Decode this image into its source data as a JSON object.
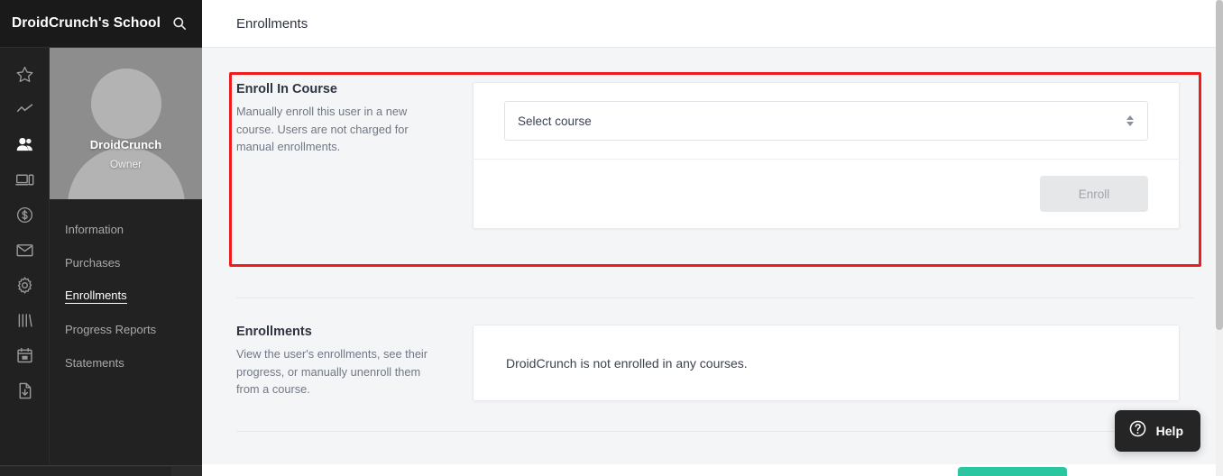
{
  "brand": {
    "title": "DroidCrunch's School",
    "search_icon": "search-icon"
  },
  "rail": {
    "items": [
      {
        "icon": "star-icon",
        "active": false
      },
      {
        "icon": "analytics-line-chart-icon",
        "active": false
      },
      {
        "icon": "users-people-icon",
        "active": true
      },
      {
        "icon": "devices-icon",
        "active": false
      },
      {
        "icon": "dollar-coin-icon",
        "active": false
      },
      {
        "icon": "mail-envelope-icon",
        "active": false
      },
      {
        "icon": "gear-settings-icon",
        "active": false
      },
      {
        "icon": "library-bars-icon",
        "active": false
      },
      {
        "icon": "calendar-icon",
        "active": false
      },
      {
        "icon": "file-download-icon",
        "active": false
      }
    ]
  },
  "profile": {
    "name": "DroidCrunch",
    "role": "Owner",
    "avatar_icon": "default-user-avatar"
  },
  "nav": {
    "items": [
      {
        "label": "Information",
        "active": false
      },
      {
        "label": "Purchases",
        "active": false
      },
      {
        "label": "Enrollments",
        "active": true
      },
      {
        "label": "Progress Reports",
        "active": false
      },
      {
        "label": "Statements",
        "active": false
      }
    ]
  },
  "header": {
    "page_title": "Enrollments"
  },
  "enroll_section": {
    "heading": "Enroll In Course",
    "description": "Manually enroll this user in a new course. Users are not charged for manual enrollments.",
    "select_value": "Select course",
    "select_placeholder": "Select course",
    "enroll_button": "Enroll"
  },
  "enrollments_section": {
    "heading": "Enrollments",
    "description": "View the user's enrollments, see their progress, or manually unenroll them from a course.",
    "empty_message": "DroidCrunch is not enrolled in any courses."
  },
  "help": {
    "label": "Help",
    "icon": "question-circle-icon"
  },
  "colors": {
    "highlight_border": "#ee1c1c",
    "accent_teal": "#2bc5a0",
    "sidebar_dark": "#1f1f1f",
    "page_background": "#f4f5f7"
  }
}
